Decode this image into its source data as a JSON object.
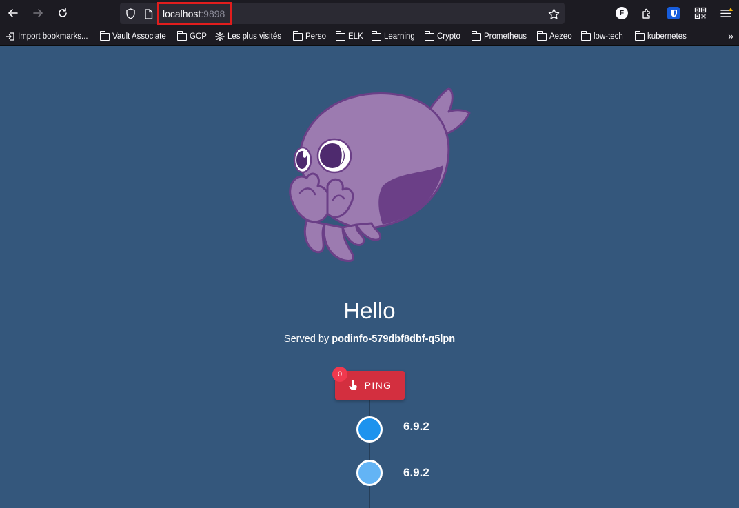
{
  "browser": {
    "url_host": "localhost",
    "url_port": ":9898",
    "icons": {
      "back": "arrow-left-icon",
      "forward": "arrow-right-icon",
      "reload": "reload-icon",
      "shield": "shield-icon",
      "page": "page-icon",
      "bookmark_star": "star-icon",
      "profile": "profile-icon",
      "extensions": "extensions-icon",
      "bitwarden": "shield-extension-icon",
      "qr": "qr-code-icon",
      "menu": "menu-icon"
    },
    "profile_letter": "F",
    "highlight_color": "#e11d1d"
  },
  "bookmarks": [
    {
      "label": "Import bookmarks...",
      "icon": "import-icon"
    },
    {
      "label": "Vault Associate",
      "icon": "folder-icon"
    },
    {
      "label": "GCP",
      "icon": "folder-icon"
    },
    {
      "label": "Les plus visités",
      "icon": "gear-icon"
    },
    {
      "label": "Perso",
      "icon": "folder-icon"
    },
    {
      "label": "ELK",
      "icon": "folder-icon"
    },
    {
      "label": "Learning",
      "icon": "folder-icon"
    },
    {
      "label": "Crypto",
      "icon": "folder-icon"
    },
    {
      "label": "Prometheus",
      "icon": "folder-icon"
    },
    {
      "label": "Aezeo",
      "icon": "folder-icon"
    },
    {
      "label": "low-tech",
      "icon": "folder-icon"
    },
    {
      "label": "kubernetes",
      "icon": "folder-icon"
    }
  ],
  "page": {
    "background": "#34577c",
    "greeting": "Hello",
    "served_prefix": "Served by ",
    "pod_name": "podinfo-579dbf8dbf-q5lpn",
    "ping": {
      "label": "PING",
      "count": "0",
      "icon": "touch-icon",
      "color": "#d32f3f"
    },
    "timeline": [
      {
        "version": "6.9.2",
        "color": "#1d93ee"
      },
      {
        "version": "6.9.2",
        "color": "#63b4f5"
      }
    ],
    "mascot": "octopus-mascot"
  }
}
